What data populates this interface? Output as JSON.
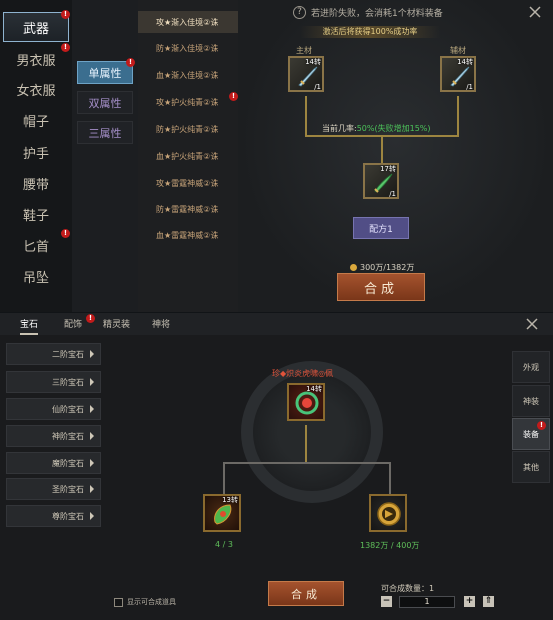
{
  "top": {
    "categories": [
      {
        "label": "武器",
        "active": true,
        "badge": "!"
      },
      {
        "label": "男衣服",
        "badge": "!"
      },
      {
        "label": "女衣服"
      },
      {
        "label": "帽子"
      },
      {
        "label": "护手"
      },
      {
        "label": "腰带"
      },
      {
        "label": "鞋子"
      },
      {
        "label": "匕首",
        "badge": "!"
      },
      {
        "label": "吊坠"
      }
    ],
    "attributes": [
      {
        "label": "单属性",
        "active": true,
        "badge": "!"
      },
      {
        "label": "双属性"
      },
      {
        "label": "三属性"
      }
    ],
    "recipes": [
      {
        "label": "攻★渐入佳境②诛",
        "active": true
      },
      {
        "label": "防★渐入佳境②诛"
      },
      {
        "label": "血★渐入佳境②诛"
      },
      {
        "label": "攻★护火纯青②诛",
        "badge": "!"
      },
      {
        "label": "防★护火纯青②诛"
      },
      {
        "label": "血★护火纯青②诛"
      },
      {
        "label": "攻★雷霆神威②诛"
      },
      {
        "label": "防★雷霆神威②诛"
      },
      {
        "label": "血★雷霆神威②诛"
      }
    ],
    "hint_text": "若进阶失败，会消耗1个材料装备",
    "banner_text": "激活后将获得100%成功率",
    "main_material_label": "主材",
    "aux_material_label": "辅材",
    "main_material_count": "14转",
    "main_material_qty": "/1",
    "aux_material_count": "14转",
    "aux_material_qty": "/1",
    "rate_label": "当前几率:",
    "rate_value": "50%(失败增加15%)",
    "result_count": "17转",
    "result_qty": "/1",
    "recipe_button": "配方1",
    "cost_text": "300万/1382万",
    "synthesize_button": "合成"
  },
  "bottom": {
    "tabs": [
      {
        "label": "宝石",
        "active": true
      },
      {
        "label": "配饰",
        "badge": "!"
      },
      {
        "label": "精灵装"
      },
      {
        "label": "神将"
      }
    ],
    "tiers": [
      "二阶宝石",
      "三阶宝石",
      "仙阶宝石",
      "神阶宝石",
      "魔阶宝石",
      "圣阶宝石",
      "尊阶宝石"
    ],
    "item_name": "珍◆炽炎虎啸◎佩",
    "result_count": "14转",
    "ingredient_left_count": "13转",
    "ingredient_left_progress": "4 / 3",
    "ingredient_right_progress": "1382万 / 400万",
    "side_tabs": [
      {
        "label": "外观"
      },
      {
        "label": "神装"
      },
      {
        "label": "装备",
        "active": true,
        "badge": "!"
      },
      {
        "label": "其他"
      }
    ],
    "synthesize_button": "合成",
    "show_checkbox_label": "显示可合成道具",
    "quantity_label": "可合成数量：",
    "quantity_max": "1",
    "quantity_value": "1",
    "minus": "−",
    "plus": "+",
    "max": "⇑"
  },
  "colors": {
    "badge_red": "#c21b1b",
    "gold_line": "#9d8540",
    "green_text": "#5fbf5a",
    "synth_orange": "#a5532e",
    "recipe_purple": "#514e86"
  }
}
